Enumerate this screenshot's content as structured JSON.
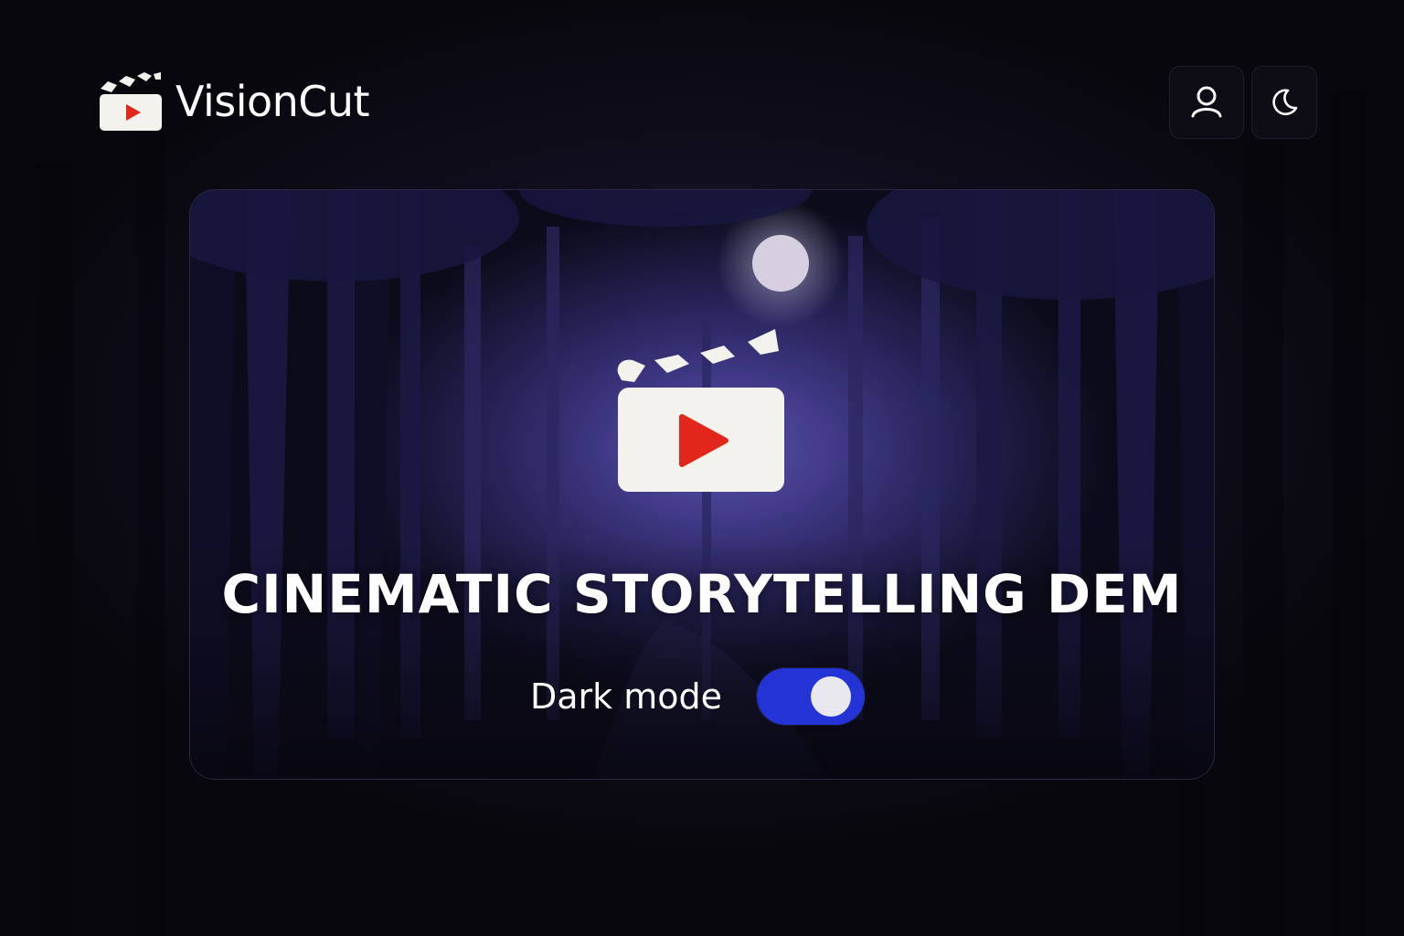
{
  "app": {
    "name": "VisionCut",
    "logo_icon": "clapperboard-play-icon"
  },
  "header": {
    "profile_icon": "user-icon",
    "theme_icon": "moon-icon"
  },
  "hero": {
    "icon": "clapperboard-play-icon",
    "title": "CINEMATIC STORYTELLING DEM",
    "background": "moonlit-forest"
  },
  "settings": {
    "dark_mode_label": "Dark mode",
    "dark_mode_on": true
  },
  "colors": {
    "accent": "#2333d6",
    "play": "#e1261c",
    "clapper": "#f4f2ec",
    "background": "#0b0a12"
  }
}
